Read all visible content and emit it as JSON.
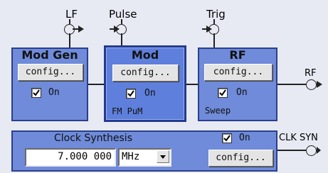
{
  "ports": {
    "lf": "LF",
    "pulse": "Pulse",
    "trig": "Trig",
    "rf": "RF",
    "clk_syn": "CLK SYN"
  },
  "blocks": {
    "mod_gen": {
      "title": "Mod Gen",
      "config": "config...",
      "on_label": "On",
      "on_checked": true
    },
    "mod": {
      "title": "Mod",
      "config": "config...",
      "on_label": "On",
      "on_checked": true,
      "sub_label": "FM PuM"
    },
    "rf": {
      "title": "RF",
      "config": "config...",
      "on_label": "On",
      "on_checked": true,
      "sub_label": "Sweep"
    }
  },
  "clock": {
    "title": "Clock Synthesis",
    "on_label": "On",
    "on_checked": true,
    "frequency_value": "7.000 000",
    "unit": "MHz",
    "config": "config..."
  }
}
